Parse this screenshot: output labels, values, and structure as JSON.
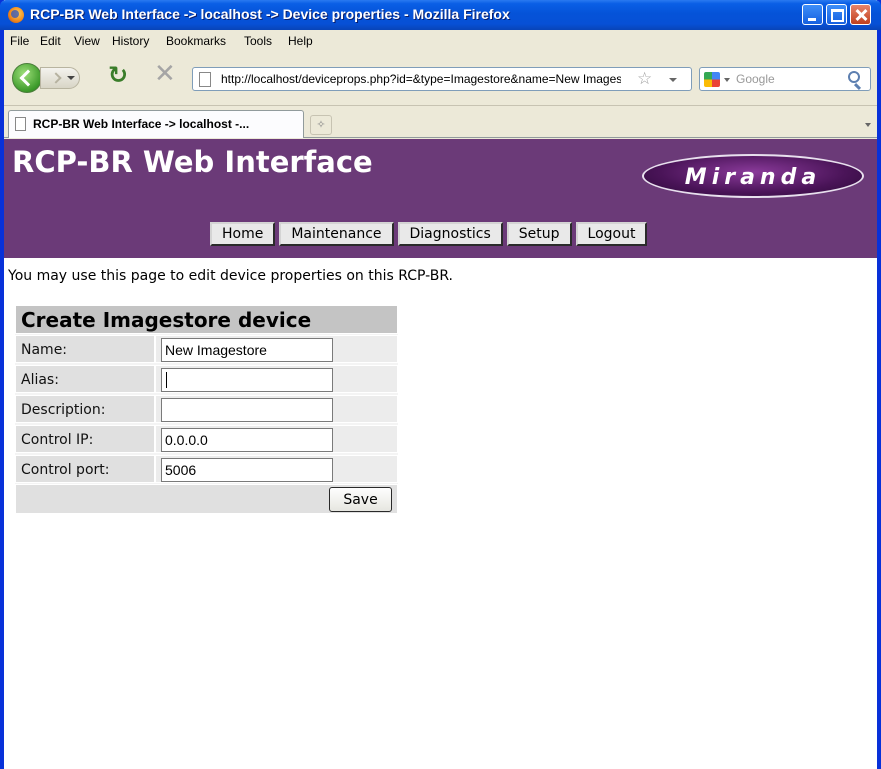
{
  "window": {
    "title": "RCP-BR Web Interface -> localhost -> Device properties - Mozilla Firefox"
  },
  "menu": [
    "File",
    "Edit",
    "View",
    "History",
    "Bookmarks",
    "Tools",
    "Help"
  ],
  "toolbar": {
    "url": "http://localhost/deviceprops.php?id=&type=Imagestore&name=New Imagestore",
    "search_placeholder": "Google"
  },
  "tab": {
    "label": "RCP-BR Web Interface -> localhost -..."
  },
  "page": {
    "site_title": "RCP-BR Web Interface",
    "logo_text": "Miranda",
    "nav": [
      "Home",
      "Maintenance",
      "Diagnostics",
      "Setup",
      "Logout"
    ],
    "intro": "You may use this page to edit device properties on this RCP-BR.",
    "form": {
      "heading": "Create Imagestore device",
      "fields": [
        {
          "label": "Name:",
          "value": ""
        },
        {
          "label": "Alias:",
          "value": ""
        },
        {
          "label": "Description:",
          "value": ""
        },
        {
          "label": "Control IP:",
          "value": "0.0.0.0"
        },
        {
          "label": "Control port:",
          "value": "5006"
        }
      ],
      "name_value": "New Imagestore",
      "save_label": "Save"
    }
  },
  "colors": {
    "banner": "#6b3a78",
    "titlebar": "#0553d8"
  },
  "icons": [
    "firefox-icon",
    "back-icon",
    "forward-icon",
    "reload-icon",
    "stop-icon",
    "page-icon",
    "bookmark-star-icon",
    "google-icon",
    "search-icon",
    "new-tab-icon"
  ]
}
